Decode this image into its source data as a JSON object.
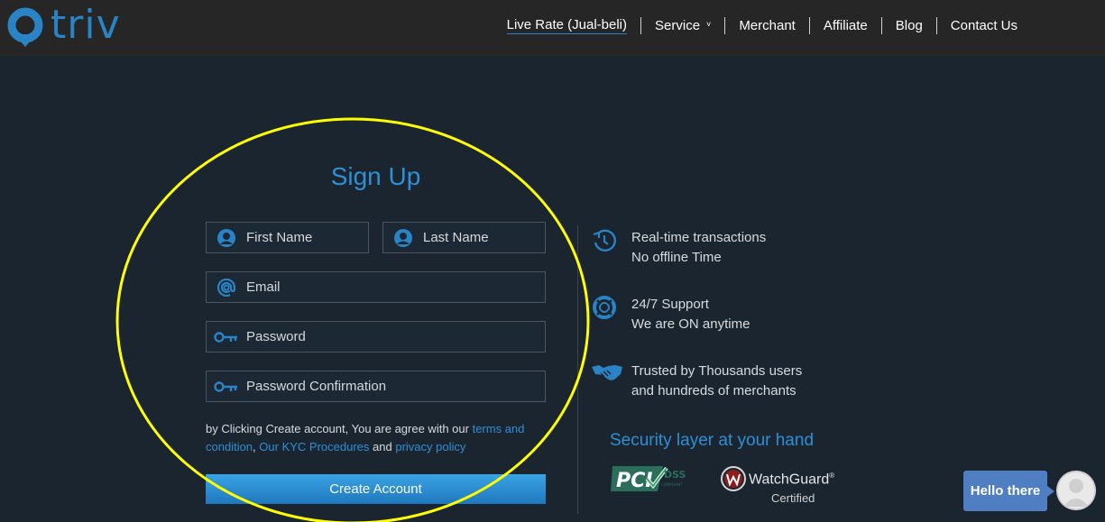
{
  "brand": {
    "logo_text": "triv",
    "accent": "#2a83c5"
  },
  "nav": {
    "items": [
      {
        "label": "Live Rate (Jual-beli)"
      },
      {
        "label": "Service"
      },
      {
        "label": "Merchant"
      },
      {
        "label": "Affiliate"
      },
      {
        "label": "Blog"
      },
      {
        "label": "Contact Us"
      }
    ],
    "service_caret": "˅"
  },
  "signup": {
    "title": "Sign Up",
    "first_name": {
      "placeholder": "First Name",
      "icon": "user-icon"
    },
    "last_name": {
      "placeholder": "Last Name",
      "icon": "user-icon"
    },
    "email": {
      "placeholder": "Email",
      "icon": "email-icon"
    },
    "password": {
      "placeholder": "Password",
      "icon": "key-icon"
    },
    "password_confirmation": {
      "placeholder": "Password Confirmation",
      "icon": "key-icon"
    },
    "agree_prefix": "by Clicking Create account, You are agree with our",
    "terms_link": "terms and condition",
    "comma": ",",
    "kyc_link": "Our KYC Procedures",
    "and": "and",
    "privacy_link": "privacy policy",
    "create_button": "Create Account"
  },
  "features": [
    {
      "line1": "Real-time transactions",
      "line2": "No offline Time",
      "icon": "clock-icon"
    },
    {
      "line1": "24/7 Support",
      "line2": "We are ON anytime",
      "icon": "support-icon"
    },
    {
      "line1": "Trusted by Thousands users",
      "line2": "and hundreds of merchants",
      "icon": "handshake-icon"
    }
  ],
  "security": {
    "title": "Security layer at your hand",
    "pci_text": "PCI",
    "pci_dss": "DSS",
    "pci_compliant": "COMPLIANT",
    "watchguard": "WatchGuard",
    "watchguard_tm": "®",
    "certified": "Certified"
  },
  "chat": {
    "greeting": "Hello there"
  },
  "annotation_color": "#ffff00"
}
